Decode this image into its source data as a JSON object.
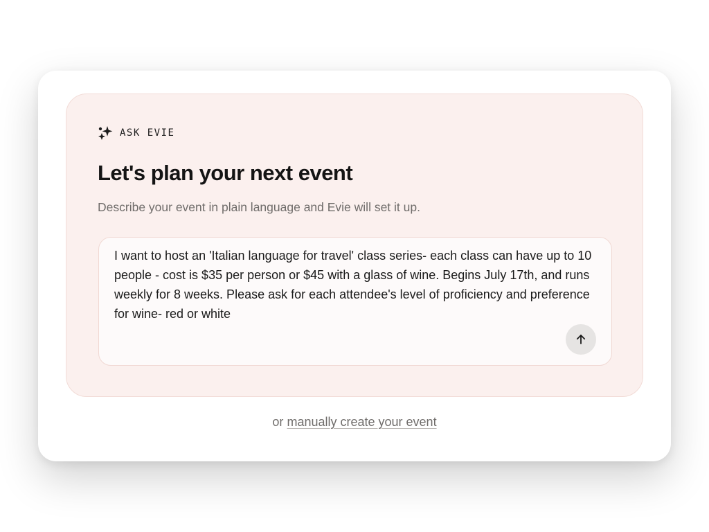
{
  "eyebrow": {
    "icon": "sparkle-icon",
    "label": "ASK EVIE"
  },
  "headline": "Let's plan your next event",
  "subhead": "Describe your event in plain language and Evie will set it up.",
  "prompt": {
    "value": "I want to host an 'Italian language for travel' class series- each class can have up to 10 people - cost is $35 per person or $45 with a glass of wine. Begins July 17th, and runs weekly for 8 weeks. Please ask for each attendee's level of proficiency and preference for wine- red or white",
    "send_icon": "arrow-up-icon"
  },
  "footer": {
    "prefix": "or",
    "link_label": "manually create your event"
  },
  "colors": {
    "panel_background": "#fbf0ee",
    "panel_border": "#f2dcd7",
    "heading_text": "#141414",
    "muted_text": "#6f6c6a",
    "send_button": "#e6e4e3"
  }
}
